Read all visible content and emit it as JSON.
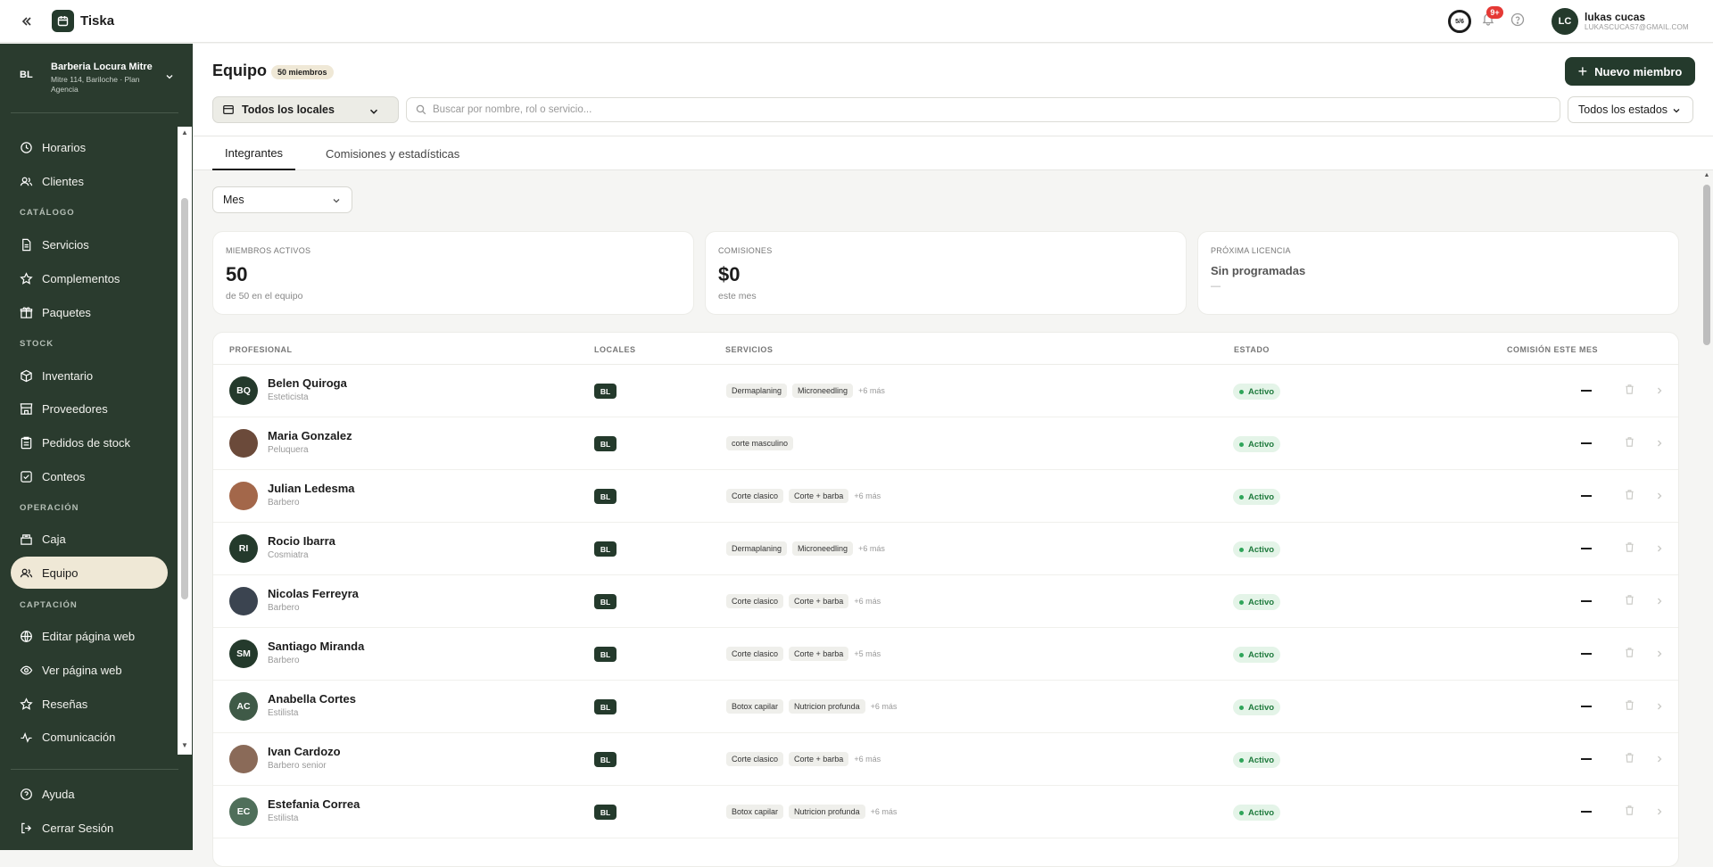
{
  "app": {
    "name": "Tiska"
  },
  "header": {
    "progress_label": "5/6",
    "notifications_badge": "9+",
    "user": {
      "initials": "LC",
      "name": "lukas cucas",
      "email": "LUKASCUCAS7@GMAIL.COM"
    }
  },
  "sidebar": {
    "business": {
      "badge": "BL",
      "name": "Barberia Locura Mitre",
      "address": "Mitre 114, Bariloche · Plan Agencia"
    },
    "items": {
      "horarios": "Horarios",
      "clientes": "Clientes",
      "catalogo_section": "CATÁLOGO",
      "servicios": "Servicios",
      "complementos": "Complementos",
      "paquetes": "Paquetes",
      "stock_section": "STOCK",
      "inventario": "Inventario",
      "proveedores": "Proveedores",
      "pedidos": "Pedidos de stock",
      "conteos": "Conteos",
      "operacion_section": "OPERACIÓN",
      "caja": "Caja",
      "equipo": "Equipo",
      "captacion_section": "CAPTACIÓN",
      "editar_web": "Editar página web",
      "ver_web": "Ver página web",
      "resenas": "Reseñas",
      "comunicacion": "Comunicación"
    },
    "bottom": {
      "ayuda": "Ayuda",
      "cerrar": "Cerrar Sesión"
    }
  },
  "page": {
    "title": "Equipo",
    "count_badge": "50 miembros",
    "new_button": "Nuevo miembro",
    "location_filter": "Todos los locales",
    "search_placeholder": "Buscar por nombre, rol o servicio...",
    "status_filter": "Todos los estados",
    "tabs": [
      "Integrantes",
      "Comisiones y estadísticas"
    ],
    "period_filter": "Mes"
  },
  "stats": {
    "active": {
      "label": "MIEMBROS ACTIVOS",
      "value": "50",
      "sub": "de 50 en el equipo"
    },
    "commissions": {
      "label": "COMISIONES",
      "value": "$0",
      "sub": "este mes"
    },
    "license": {
      "label": "PRÓXIMA LICENCIA",
      "value": "Sin programadas",
      "sub": "—"
    }
  },
  "table": {
    "headers": {
      "professional": "PROFESIONAL",
      "locations": "LOCALES",
      "services": "SERVICIOS",
      "status": "ESTADO",
      "commission": "COMISIÓN ESTE MES"
    },
    "rows": [
      {
        "initials": "BQ",
        "avatar_color": "#243a2c",
        "name": "Belen Quiroga",
        "role": "Esteticista",
        "location": "BL",
        "services": [
          "Dermaplaning",
          "Microneedling"
        ],
        "more": "+6 más",
        "status": "Activo",
        "commission": "—"
      },
      {
        "initials": "",
        "avatar_color": "#6b4a3a",
        "name": "Maria Gonzalez",
        "role": "Peluquera",
        "location": "BL",
        "services": [
          "corte masculino"
        ],
        "more": "",
        "status": "Activo",
        "commission": "—"
      },
      {
        "initials": "",
        "avatar_color": "#a3674a",
        "name": "Julian Ledesma",
        "role": "Barbero",
        "location": "BL",
        "services": [
          "Corte clasico",
          "Corte + barba"
        ],
        "more": "+6 más",
        "status": "Activo",
        "commission": "—"
      },
      {
        "initials": "RI",
        "avatar_color": "#243a2c",
        "name": "Rocio Ibarra",
        "role": "Cosmiatra",
        "location": "BL",
        "services": [
          "Dermaplaning",
          "Microneedling"
        ],
        "more": "+6 más",
        "status": "Activo",
        "commission": "—"
      },
      {
        "initials": "",
        "avatar_color": "#3b4450",
        "name": "Nicolas Ferreyra",
        "role": "Barbero",
        "location": "BL",
        "services": [
          "Corte clasico",
          "Corte + barba"
        ],
        "more": "+6 más",
        "status": "Activo",
        "commission": "—"
      },
      {
        "initials": "SM",
        "avatar_color": "#243a2c",
        "name": "Santiago Miranda",
        "role": "Barbero",
        "location": "BL",
        "services": [
          "Corte clasico",
          "Corte + barba"
        ],
        "more": "+5 más",
        "status": "Activo",
        "commission": "—"
      },
      {
        "initials": "AC",
        "avatar_color": "#3f5a47",
        "name": "Anabella Cortes",
        "role": "Estilista",
        "location": "BL",
        "services": [
          "Botox capilar",
          "Nutricion profunda"
        ],
        "more": "+6 más",
        "status": "Activo",
        "commission": "—"
      },
      {
        "initials": "",
        "avatar_color": "#8a6a58",
        "name": "Ivan Cardozo",
        "role": "Barbero senior",
        "location": "BL",
        "services": [
          "Corte clasico",
          "Corte + barba"
        ],
        "more": "+6 más",
        "status": "Activo",
        "commission": "—"
      },
      {
        "initials": "EC",
        "avatar_color": "#4f6f5a",
        "name": "Estefania Correa",
        "role": "Estilista",
        "location": "BL",
        "services": [
          "Botox capilar",
          "Nutricion profunda"
        ],
        "more": "+6 más",
        "status": "Activo",
        "commission": "—"
      }
    ]
  }
}
